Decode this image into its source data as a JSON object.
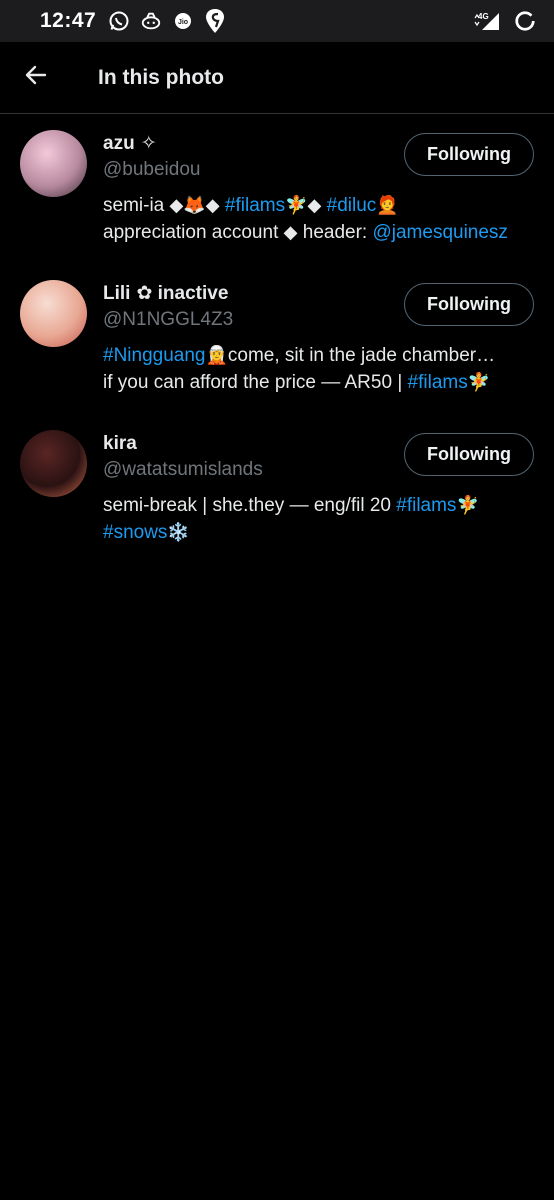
{
  "status_bar": {
    "time": "12:47",
    "left_icons": [
      "whatsapp-icon",
      "chat-app-icon",
      "jio-icon",
      "swiggy-icon"
    ],
    "network_label": "4G",
    "right_icons": [
      "signal-icon",
      "battery-saver-icon"
    ]
  },
  "header": {
    "title": "In this photo",
    "back_icon": "arrow-left-icon"
  },
  "users": [
    {
      "display_name": "azu",
      "name_suffix": "✧",
      "handle": "@bubeidou",
      "follow_label": "Following",
      "bio_line1": [
        {
          "t": "semi-ia "
        },
        {
          "t": "◆",
          "e": true
        },
        {
          "t": " 🦊 ",
          "e": true
        },
        {
          "t": "◆",
          "e": true
        },
        {
          "t": " "
        },
        {
          "t": "#filams",
          "l": true
        },
        {
          "t": " 🧚 ",
          "e": true
        },
        {
          "t": "◆",
          "e": true
        },
        {
          "t": " "
        },
        {
          "t": "#diluc",
          "l": true
        },
        {
          "t": " 🧑‍🦰",
          "e": true
        }
      ],
      "bio_line2": [
        {
          "t": "appreciation account "
        },
        {
          "t": "◆",
          "e": true
        },
        {
          "t": " header: "
        },
        {
          "t": "@jamesquinesz",
          "l": true
        }
      ],
      "avatar_colors": [
        "#f3c9d8",
        "#b88aa0",
        "#3a2a33"
      ]
    },
    {
      "display_name": "Lili",
      "name_suffix": "✿ inactive",
      "handle": "@N1NGGL4Z3",
      "follow_label": "Following",
      "bio_line1": [
        {
          "t": "#Ningguang",
          "l": true
        },
        {
          "t": " 🧝 ",
          "e": true
        },
        {
          "t": "come, sit in the jade chamber…"
        }
      ],
      "bio_line2": [
        {
          "t": "if you can afford the price — AR50 | "
        },
        {
          "t": "#filams",
          "l": true
        },
        {
          "t": " 🧚",
          "e": true
        }
      ],
      "avatar_colors": [
        "#f7ddd2",
        "#e8a894",
        "#c4574a"
      ]
    },
    {
      "display_name": "kira",
      "name_suffix": "",
      "handle": "@watatsumislands",
      "follow_label": "Following",
      "bio_line1": [
        {
          "t": "semi-break | she.they — eng/fil 20 "
        },
        {
          "t": "#filams",
          "l": true
        },
        {
          "t": " 🧚",
          "e": true
        }
      ],
      "bio_line2": [
        {
          "t": "#snows",
          "l": true
        },
        {
          "t": " ❄️",
          "e": true
        }
      ],
      "avatar_colors": [
        "#5a2524",
        "#2a1212",
        "#c9684e"
      ]
    }
  ]
}
